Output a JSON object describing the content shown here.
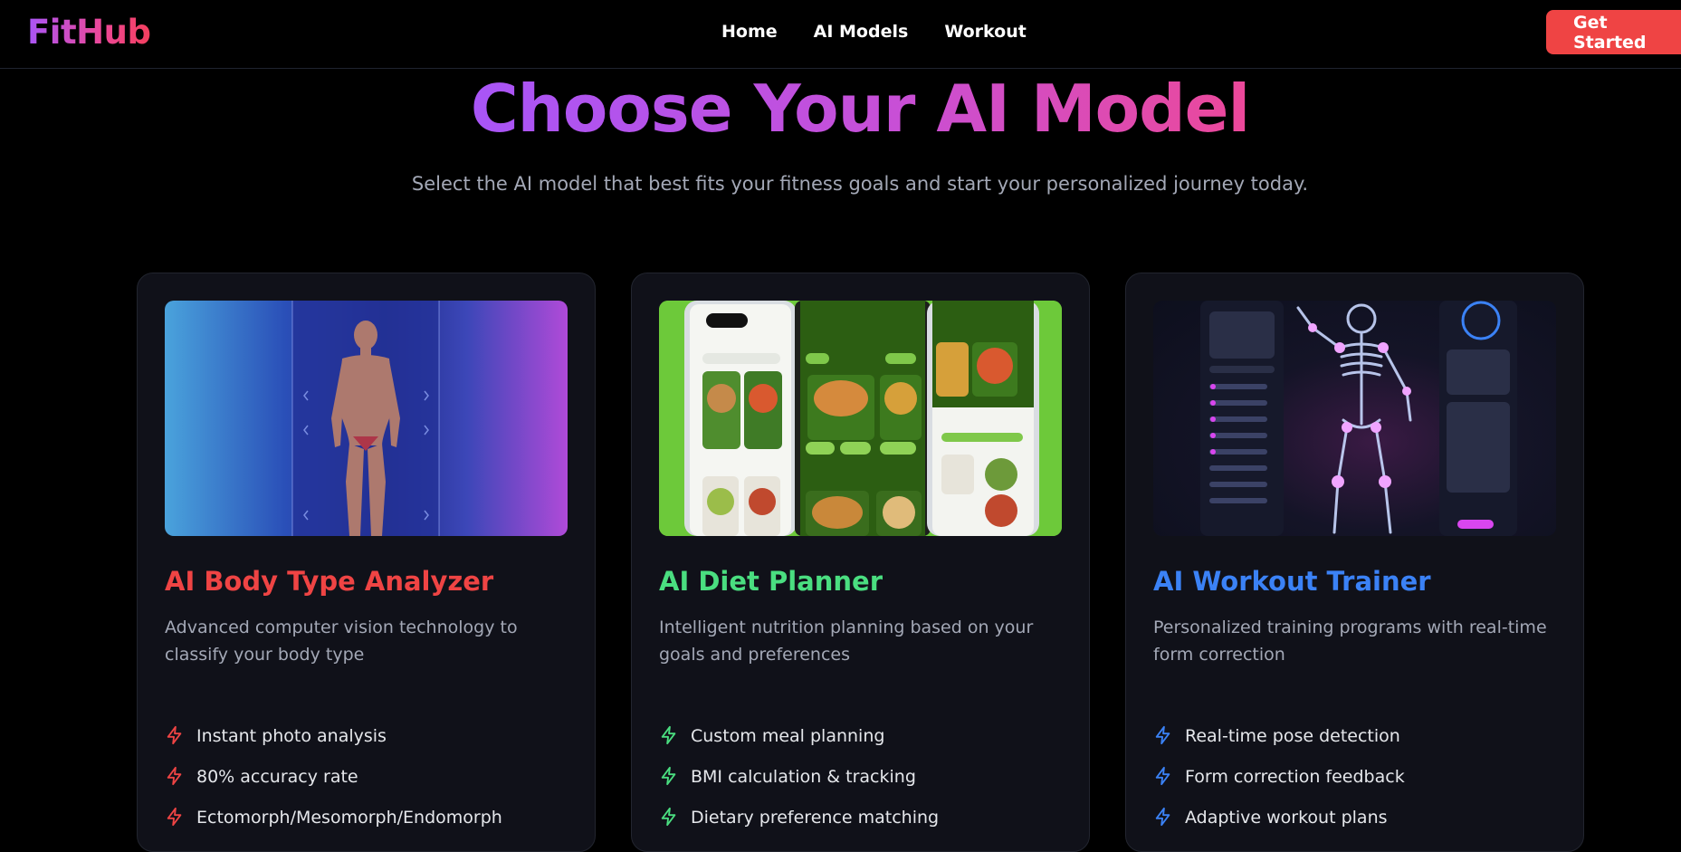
{
  "nav": {
    "logo": "FitHub",
    "links": [
      "Home",
      "AI Models",
      "Workout"
    ],
    "cta": "Get Started"
  },
  "hero": {
    "title": "Choose Your AI Model",
    "subtitle": "Select the AI model that best fits your fitness goals and start your personalized journey today."
  },
  "cards": [
    {
      "title": "AI Body Type Analyzer",
      "description": "Advanced computer vision technology to classify your body type",
      "accent": "#ef4444",
      "features": [
        "Instant photo analysis",
        "80% accuracy rate",
        "Ectomorph/Mesomorph/Endomorph"
      ]
    },
    {
      "title": "AI Diet Planner",
      "description": "Intelligent nutrition planning based on your goals and preferences",
      "accent": "#4ade80",
      "features": [
        "Custom meal planning",
        "BMI calculation & tracking",
        "Dietary preference matching"
      ]
    },
    {
      "title": "AI Workout Trainer",
      "description": "Personalized training programs with real-time form correction",
      "accent": "#3b82f6",
      "features": [
        "Real-time pose detection",
        "Form correction feedback",
        "Adaptive workout plans"
      ]
    }
  ],
  "icons": {
    "feature": "lightning-bolt-icon"
  }
}
